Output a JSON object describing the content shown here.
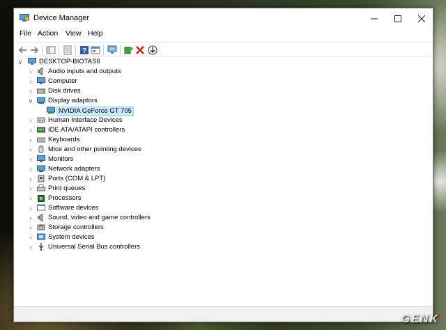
{
  "window": {
    "title": "Device Manager"
  },
  "menu": [
    "File",
    "Action",
    "View",
    "Help"
  ],
  "tree": {
    "root": "DESKTOP-BIOTAS6",
    "items": [
      {
        "label": "Audio inputs and outputs",
        "icon": "speaker-icon",
        "expanded": false
      },
      {
        "label": "Computer",
        "icon": "monitor-icon",
        "expanded": false
      },
      {
        "label": "Disk drives",
        "icon": "disk-icon",
        "expanded": false
      },
      {
        "label": "Display adaptors",
        "icon": "display-adapter-icon",
        "expanded": true,
        "children": [
          {
            "label": "NVIDIA GeForce GT 705",
            "icon": "display-adapter-icon",
            "selected": true
          }
        ]
      },
      {
        "label": "Human Interface Devices",
        "icon": "hid-icon",
        "expanded": false
      },
      {
        "label": "IDE ATA/ATAPI controllers",
        "icon": "ide-icon",
        "expanded": false
      },
      {
        "label": "Keyboards",
        "icon": "keyboard-icon",
        "expanded": false
      },
      {
        "label": "Mice and other pointing devices",
        "icon": "mouse-icon",
        "expanded": false
      },
      {
        "label": "Monitors",
        "icon": "monitor-icon",
        "expanded": false
      },
      {
        "label": "Network adapters",
        "icon": "network-icon",
        "expanded": false
      },
      {
        "label": "Ports (COM & LPT)",
        "icon": "port-icon",
        "expanded": false
      },
      {
        "label": "Print queues",
        "icon": "printer-icon",
        "expanded": false
      },
      {
        "label": "Processors",
        "icon": "cpu-icon",
        "expanded": false
      },
      {
        "label": "Software devices",
        "icon": "software-icon",
        "expanded": false
      },
      {
        "label": "Sound, video and game controllers",
        "icon": "speaker-icon",
        "expanded": false
      },
      {
        "label": "Storage controllers",
        "icon": "storage-icon",
        "expanded": false
      },
      {
        "label": "System devices",
        "icon": "system-icon",
        "expanded": false
      },
      {
        "label": "Universal Serial Bus controllers",
        "icon": "usb-icon",
        "expanded": false
      }
    ]
  },
  "watermark": "GENK",
  "colors": {
    "selection_bg": "#cce8ff",
    "selection_border": "#99d1ff"
  }
}
